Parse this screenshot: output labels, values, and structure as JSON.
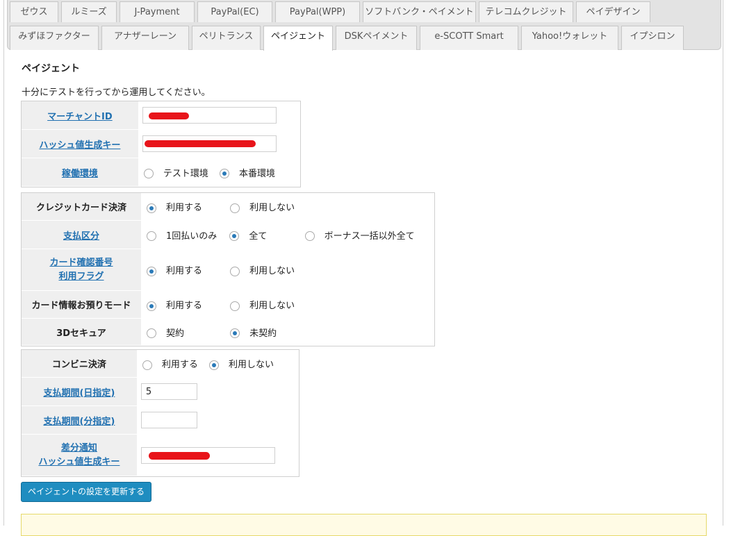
{
  "tabs": {
    "row1": [
      {
        "label": "ゼウス"
      },
      {
        "label": "ルミーズ"
      },
      {
        "label": "J-Payment"
      },
      {
        "label": "PayPal(EC)"
      },
      {
        "label": "PayPal(WPP)"
      },
      {
        "label": "ソフトバンク・ペイメント"
      },
      {
        "label": "テレコムクレジット"
      },
      {
        "label": "ペイデザイン"
      }
    ],
    "row2": [
      {
        "label": "みずほファクター"
      },
      {
        "label": "アナザーレーン"
      },
      {
        "label": "ペリトランス"
      },
      {
        "label": "ペイジェント"
      },
      {
        "label": "DSKペイメント"
      },
      {
        "label": "e-SCOTT Smart"
      },
      {
        "label": "Yahoo!ウォレット"
      },
      {
        "label": "イプシロン"
      }
    ],
    "active": "ペイジェント"
  },
  "section": {
    "title": "ペイジェント",
    "note": "十分にテストを行ってから運用してください。"
  },
  "basic": {
    "merchant_id_label": "マーチャントID",
    "merchant_id_value": "",
    "hash_key_label": "ハッシュ値生成キー",
    "hash_key_value": "",
    "env_label": "稼働環境",
    "env_test": "テスト環境",
    "env_prod": "本番環境",
    "env_selected": "本番環境"
  },
  "card": {
    "credit_label": "クレジットカード決済",
    "use": "利用する",
    "nouse": "利用しない",
    "pay_label": "支払区分",
    "pay_opt1": "1回払いのみ",
    "pay_opt2": "全て",
    "pay_opt3": "ボーナス一括以外全て",
    "cvv_label_1": "カード確認番号",
    "cvv_label_2": "利用フラグ",
    "store_label": "カード情報お預りモード",
    "tds_label": "3Dセキュア",
    "tds_opt1": "契約",
    "tds_opt2": "未契約"
  },
  "conv": {
    "label": "コンビニ決済",
    "use": "利用する",
    "nouse": "利用しない",
    "days_label": "支払期間(日指定)",
    "days_value": "5",
    "minutes_label": "支払期間(分指定)",
    "minutes_value": "",
    "notify_label_1": "差分通知",
    "notify_label_2": "ハッシュ値生成キー",
    "notify_value": ""
  },
  "update_button": "ペイジェントの設定を更新する",
  "colors": {
    "link": "#2271b1",
    "button": "#1f8dc0",
    "radio_selected": "#2a7ab8",
    "redaction": "#e8141a"
  }
}
